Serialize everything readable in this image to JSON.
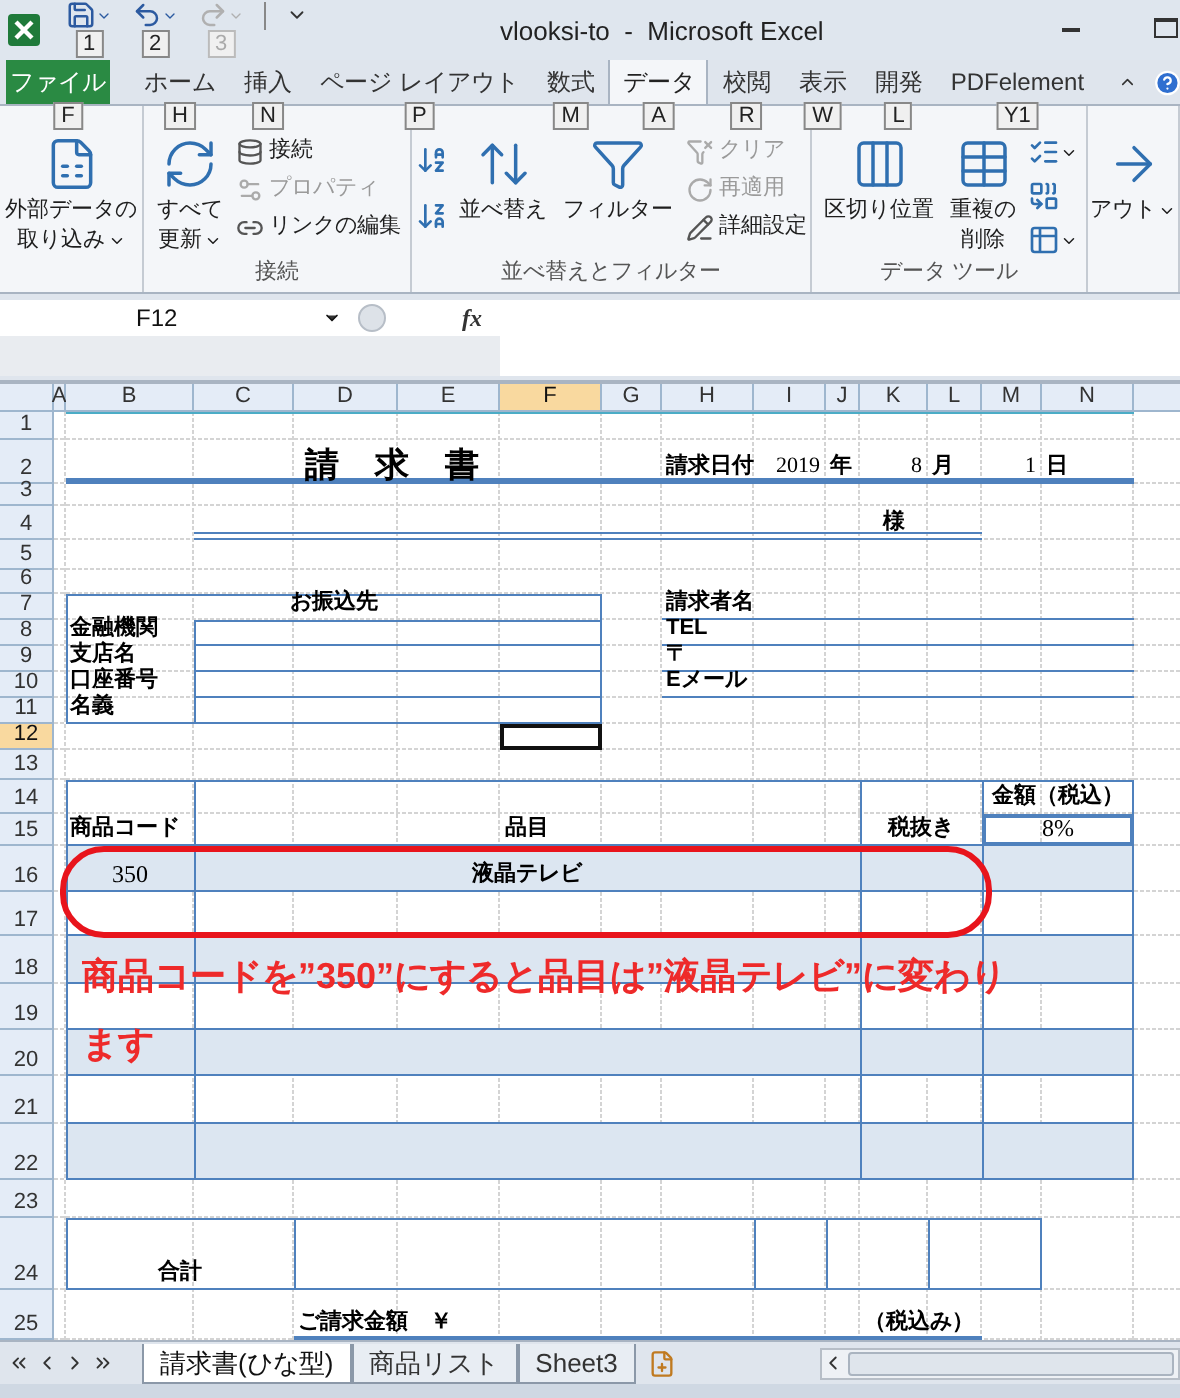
{
  "window": {
    "title": "vlooksi-to  -  Microsoft Excel"
  },
  "quick_access": [
    {
      "kind": "save",
      "keytip": "1",
      "disabled": false
    },
    {
      "kind": "undo",
      "keytip": "2",
      "disabled": false
    },
    {
      "kind": "redo",
      "keytip": "3",
      "disabled": true
    }
  ],
  "ribbon_tabs": [
    {
      "label": "ファイル",
      "keytip": "F",
      "kind": "file",
      "selected": false
    },
    {
      "label": "ホーム",
      "keytip": "H",
      "kind": "tab",
      "selected": false
    },
    {
      "label": "挿入",
      "keytip": "N",
      "kind": "tab",
      "selected": false
    },
    {
      "label": "ページ レイアウト",
      "keytip": "P",
      "kind": "tab",
      "selected": false
    },
    {
      "label": "数式",
      "keytip": "M",
      "kind": "tab",
      "selected": false
    },
    {
      "label": "データ",
      "keytip": "A",
      "kind": "tab",
      "selected": true
    },
    {
      "label": "校閲",
      "keytip": "R",
      "kind": "tab",
      "selected": false
    },
    {
      "label": "表示",
      "keytip": "W",
      "kind": "tab",
      "selected": false
    },
    {
      "label": "開発",
      "keytip": "L",
      "kind": "tab",
      "selected": false
    },
    {
      "label": "PDFelement",
      "keytip": "Y1",
      "kind": "tab",
      "selected": false
    }
  ],
  "ribbon_groups": [
    {
      "buttons": [
        {
          "kind": "large",
          "lines": [
            "外部データの",
            "取り込み"
          ],
          "dropdown": true,
          "disabled": false
        }
      ]
    },
    {
      "label": "接続",
      "buttons": [
        {
          "kind": "large",
          "lines": [
            "すべて",
            "更新"
          ],
          "dropdown": true,
          "disabled": false
        },
        {
          "kind": "small",
          "lines": [
            "接続"
          ],
          "dropdown": false,
          "disabled": false
        },
        {
          "kind": "small",
          "lines": [
            "プロパティ"
          ],
          "dropdown": false,
          "disabled": true
        },
        {
          "kind": "small",
          "lines": [
            "リンクの編集"
          ],
          "dropdown": false,
          "disabled": false
        }
      ]
    },
    {
      "label": "並べ替えとフィルター",
      "buttons": [
        {
          "kind": "icon",
          "dropdown": false,
          "disabled": false
        },
        {
          "kind": "icon",
          "dropdown": false,
          "disabled": false
        },
        {
          "kind": "large",
          "lines": [
            "並べ替え"
          ],
          "dropdown": false,
          "disabled": false
        },
        {
          "kind": "large",
          "lines": [
            "フィルター"
          ],
          "dropdown": false,
          "disabled": false
        },
        {
          "kind": "small",
          "lines": [
            "クリア"
          ],
          "dropdown": false,
          "disabled": true
        },
        {
          "kind": "small",
          "lines": [
            "再適用"
          ],
          "dropdown": false,
          "disabled": true
        },
        {
          "kind": "small",
          "lines": [
            "詳細設定"
          ],
          "dropdown": false,
          "disabled": false
        }
      ]
    },
    {
      "label": "データ ツール",
      "buttons": [
        {
          "kind": "large",
          "lines": [
            "区切り位置"
          ],
          "dropdown": false,
          "disabled": false
        },
        {
          "kind": "large",
          "lines": [
            "重複の",
            "削除"
          ],
          "dropdown": false,
          "disabled": false
        },
        {
          "kind": "icon",
          "dropdown": true,
          "disabled": false
        },
        {
          "kind": "icon",
          "dropdown": false,
          "disabled": false
        },
        {
          "kind": "icon",
          "dropdown": true,
          "disabled": false
        }
      ]
    },
    {
      "buttons": [
        {
          "kind": "large",
          "lines": [
            "アウト"
          ],
          "dropdown": true,
          "disabled": false
        }
      ]
    }
  ],
  "name_box": {
    "value": "F12"
  },
  "formula_bar": {
    "function_label": "fx"
  },
  "columns": [
    {
      "label": "A",
      "selected": false
    },
    {
      "label": "B",
      "selected": false
    },
    {
      "label": "C",
      "selected": false
    },
    {
      "label": "D",
      "selected": false
    },
    {
      "label": "E",
      "selected": false
    },
    {
      "label": "F",
      "selected": true
    },
    {
      "label": "G",
      "selected": false
    },
    {
      "label": "H",
      "selected": false
    },
    {
      "label": "I",
      "selected": false
    },
    {
      "label": "J",
      "selected": false
    },
    {
      "label": "K",
      "selected": false
    },
    {
      "label": "L",
      "selected": false
    },
    {
      "label": "M",
      "selected": false
    },
    {
      "label": "N",
      "selected": false
    }
  ],
  "rows": [
    {
      "label": "1",
      "selected": false
    },
    {
      "label": "2",
      "selected": false,
      "cells": {
        "C:F": {
          "text": "請 求 書",
          "kind": "title"
        },
        "H": {
          "text": "請求日付",
          "kind": "label"
        },
        "I": {
          "text": "2019",
          "kind": "number"
        },
        "J": {
          "text": "年",
          "kind": "label"
        },
        "K": {
          "text": "8",
          "kind": "number"
        },
        "L": {
          "text": "月",
          "kind": "label"
        },
        "M": {
          "text": "1",
          "kind": "number"
        },
        "N": {
          "text": "日",
          "kind": "label"
        }
      }
    },
    {
      "label": "3",
      "selected": false
    },
    {
      "label": "4",
      "selected": false,
      "cells": {
        "K": {
          "text": "様",
          "kind": "heading"
        }
      }
    },
    {
      "label": "5",
      "selected": false
    },
    {
      "label": "6",
      "selected": false
    },
    {
      "label": "7",
      "selected": false,
      "cells": {
        "B:F": {
          "text": "お振込先",
          "kind": "heading"
        },
        "H": {
          "text": "請求者名",
          "kind": "label"
        }
      }
    },
    {
      "label": "8",
      "selected": false,
      "cells": {
        "B": {
          "text": "金融機関",
          "kind": "label"
        },
        "H": {
          "text": "TEL",
          "kind": "label"
        }
      }
    },
    {
      "label": "9",
      "selected": false,
      "cells": {
        "B": {
          "text": "支店名",
          "kind": "label"
        },
        "H": {
          "text": "〒",
          "kind": "label"
        }
      }
    },
    {
      "label": "10",
      "selected": false,
      "cells": {
        "B": {
          "text": "口座番号",
          "kind": "label"
        },
        "H": {
          "text": "Eメール",
          "kind": "label"
        }
      }
    },
    {
      "label": "11",
      "selected": false,
      "cells": {
        "B": {
          "text": "名義",
          "kind": "label"
        }
      }
    },
    {
      "label": "12",
      "selected": true
    },
    {
      "label": "13",
      "selected": false
    },
    {
      "label": "14",
      "selected": false,
      "cells": {
        "M:N": {
          "text": "金額（税込）",
          "kind": "heading"
        }
      }
    },
    {
      "label": "15",
      "selected": false,
      "cells": {
        "B": {
          "text": "商品コード",
          "kind": "label"
        },
        "C:J": {
          "text": "品目",
          "kind": "heading"
        },
        "K:L": {
          "text": "税抜き",
          "kind": "heading"
        },
        "M:N": {
          "text": "8%",
          "kind": "center"
        }
      }
    },
    {
      "label": "16",
      "selected": false,
      "cells": {
        "B": {
          "text": "350",
          "kind": "center"
        },
        "C:J": {
          "text": "液晶テレビ",
          "kind": "heading"
        }
      }
    },
    {
      "label": "17",
      "selected": false
    },
    {
      "label": "18",
      "selected": false
    },
    {
      "label": "19",
      "selected": false
    },
    {
      "label": "20",
      "selected": false
    },
    {
      "label": "21",
      "selected": false
    },
    {
      "label": "22",
      "selected": false
    },
    {
      "label": "23",
      "selected": false
    },
    {
      "label": "24",
      "selected": false,
      "cells": {
        "B:C": {
          "text": "合計",
          "kind": "heading"
        }
      }
    },
    {
      "label": "25",
      "selected": false,
      "cells": {
        "D:G": {
          "text": "ご請求金額　￥",
          "kind": "label"
        },
        "K:L": {
          "text": "（税込み）",
          "kind": "label"
        }
      }
    }
  ],
  "annotation": {
    "text": "商品コードを”350”にすると品目は”液晶テレビ”に変わります"
  },
  "sheet_tabs": [
    {
      "label": "請求書(ひな型)",
      "selected": true
    },
    {
      "label": "商品リスト",
      "selected": false
    },
    {
      "label": "Sheet3",
      "selected": false
    }
  ]
}
